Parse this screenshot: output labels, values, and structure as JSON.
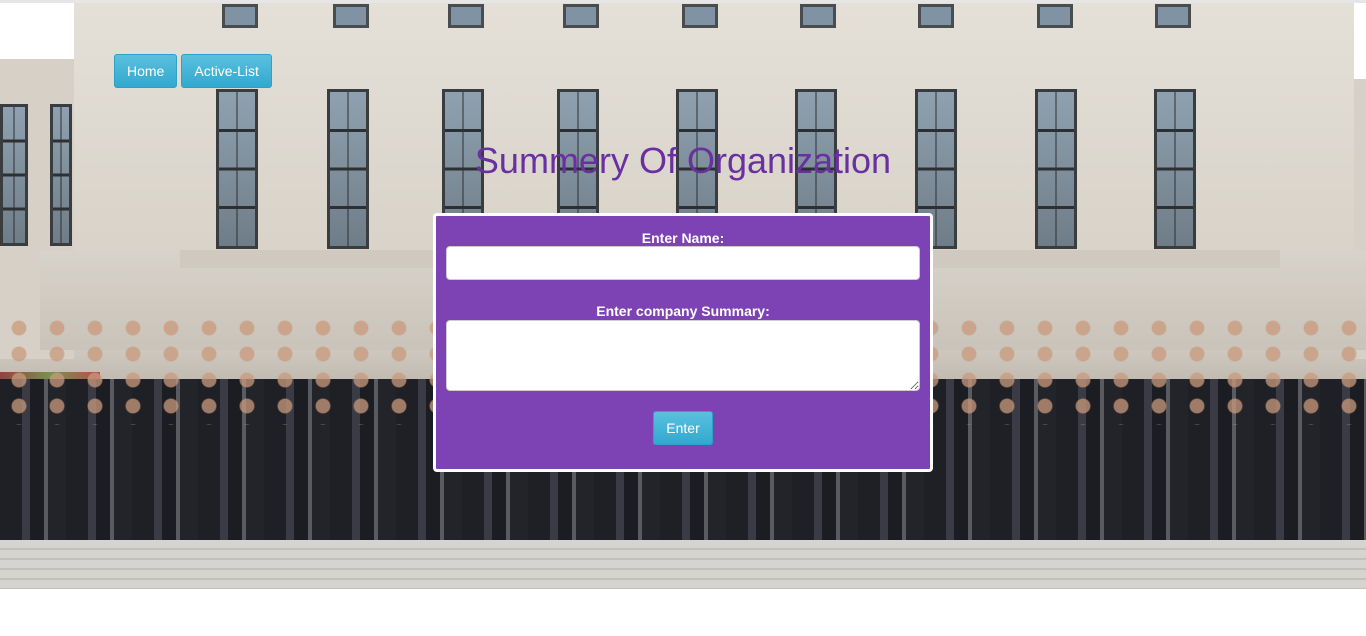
{
  "nav": {
    "items": [
      {
        "label": "Home"
      },
      {
        "label": "Active-List"
      }
    ]
  },
  "page": {
    "title": "Summery Of Organization"
  },
  "form": {
    "name_label": "Enter Name:",
    "name_value": "",
    "summary_label": "Enter company Summary:",
    "summary_value": "",
    "submit_label": "Enter"
  },
  "colors": {
    "title": "#6a2fa0",
    "panel": "#7d43b5",
    "button": "#5bc0de"
  }
}
